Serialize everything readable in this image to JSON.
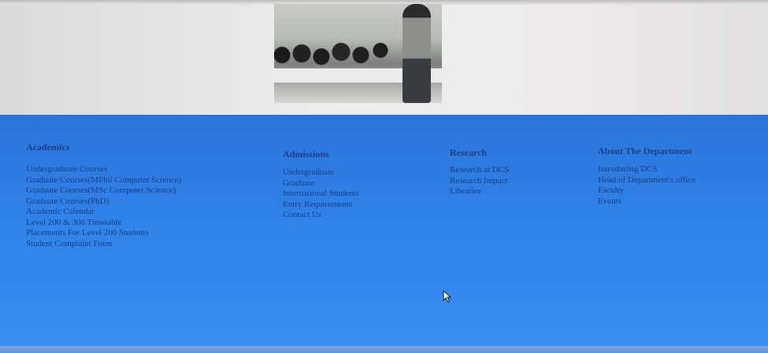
{
  "hero": {
    "image": "lecture-classroom-photo"
  },
  "footer": {
    "columns": [
      {
        "title": "Academics",
        "links": [
          "Undergraduate Courses",
          "Graduate Courses(MPhil Computer Science)",
          "Graduate Courses(MSc Computer Science)",
          "Graduate Courses(PhD)",
          "Academic Calendar",
          "Level 200 & 300 Timetable",
          "Placements For Level 200 Students",
          "Student Complaint Form"
        ]
      },
      {
        "title": "Admissions",
        "links": [
          "Undergraduate",
          "Graduate",
          "International Students",
          "Entry Requirements",
          "Contact Us"
        ]
      },
      {
        "title": "Research",
        "links": [
          "Research at DCS",
          "Research Impact",
          "Libraries"
        ]
      },
      {
        "title": "About The Department",
        "links": [
          "Introducing DCS",
          "Head of Department's office",
          "Faculty",
          "Events"
        ]
      }
    ]
  },
  "colors": {
    "footer_background": "#2f83ea",
    "footer_text": "#1f3c7c"
  },
  "icons": {
    "cursor": "mouse-pointer-icon"
  }
}
